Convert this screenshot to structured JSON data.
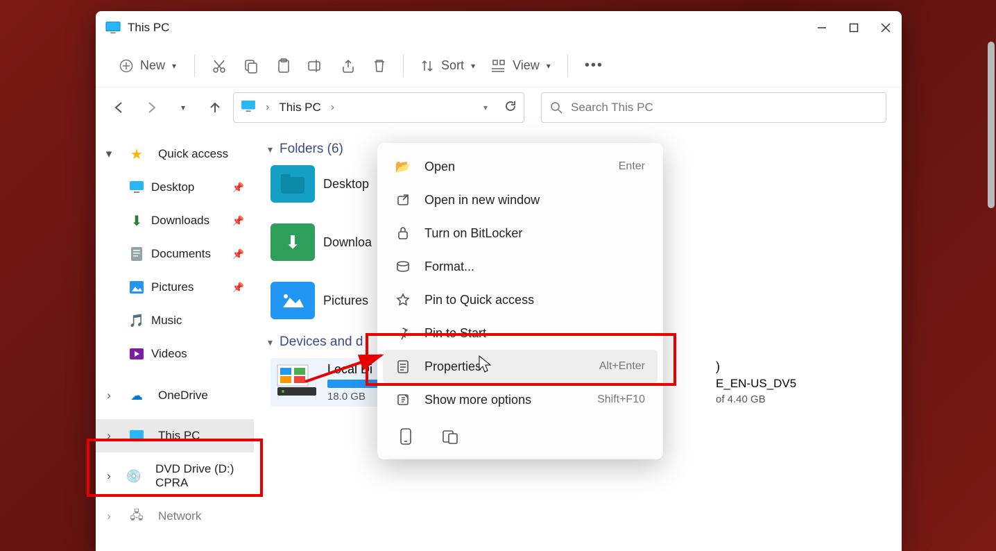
{
  "title": "This PC",
  "toolbar": {
    "new_label": "New",
    "sort_label": "Sort",
    "view_label": "View"
  },
  "breadcrumb": {
    "root": "This PC"
  },
  "search": {
    "placeholder": "Search This PC"
  },
  "sidebar": {
    "quick_access": "Quick access",
    "items": [
      {
        "label": "Desktop",
        "pinned": true
      },
      {
        "label": "Downloads",
        "pinned": true
      },
      {
        "label": "Documents",
        "pinned": true
      },
      {
        "label": "Pictures",
        "pinned": true
      },
      {
        "label": "Music",
        "pinned": false
      },
      {
        "label": "Videos",
        "pinned": false
      }
    ],
    "onedrive": "OneDrive",
    "this_pc": "This PC",
    "dvd": "DVD Drive (D:) CPRA",
    "network": "Network"
  },
  "sections": {
    "folders": "Folders (6)",
    "devices": "Devices and d"
  },
  "folders": [
    {
      "label": "Desktop"
    },
    {
      "label": "Downloa"
    },
    {
      "label": "Pictures"
    }
  ],
  "drives": {
    "local": {
      "name": "Local Di",
      "free": "18.0 GB",
      "fill_pct": 62
    },
    "dvd": {
      "name_suffix": ")",
      "line": "E_EN-US_DV5",
      "free": "of 4.40 GB"
    }
  },
  "context_menu": {
    "open": "Open",
    "open_sc": "Enter",
    "open_new": "Open in new window",
    "bitlocker": "Turn on BitLocker",
    "format": "Format...",
    "pin_quick": "Pin to Quick access",
    "pin_start": "Pin to Start",
    "properties": "Properties",
    "properties_sc": "Alt+Enter",
    "show_more": "Show more options",
    "show_more_sc": "Shift+F10"
  }
}
